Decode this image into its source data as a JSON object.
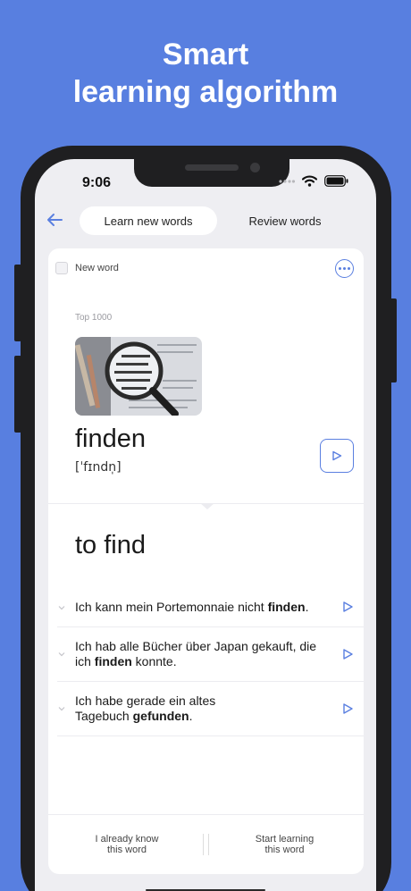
{
  "headline": {
    "line1": "Smart",
    "line2": "learning algorithm"
  },
  "status_bar": {
    "time": "9:06",
    "icons": [
      "signal-dots-icon",
      "wifi-icon",
      "battery-icon"
    ]
  },
  "nav": {
    "back_icon": "back-arrow-icon",
    "tabs": [
      {
        "label": "Learn new words",
        "active": true
      },
      {
        "label": "Review words",
        "active": false
      }
    ]
  },
  "card": {
    "new_word_label": "New word",
    "more_icon": "more-dots-icon",
    "category": "Top 1000",
    "word": "finden",
    "transcription": "[ˈfɪndn̩]",
    "translation": "to find",
    "examples": [
      {
        "before": "Ich kann mein Portemonnaie nicht ",
        "bold": "finden",
        "after": "."
      },
      {
        "before": "Ich hab alle Bücher über Japan gekauft, die ich ",
        "bold": "finden",
        "after": " konnte."
      },
      {
        "before": "Ich habe gerade ein altes Tagebuch ",
        "bold": "gefunden",
        "after": "."
      }
    ]
  },
  "actions": {
    "know_line1": "I already know",
    "know_line2": "this word",
    "learn_line1": "Start learning",
    "learn_line2": "this word"
  },
  "colors": {
    "background": "#587fe0",
    "accent": "#5a7fe0"
  }
}
